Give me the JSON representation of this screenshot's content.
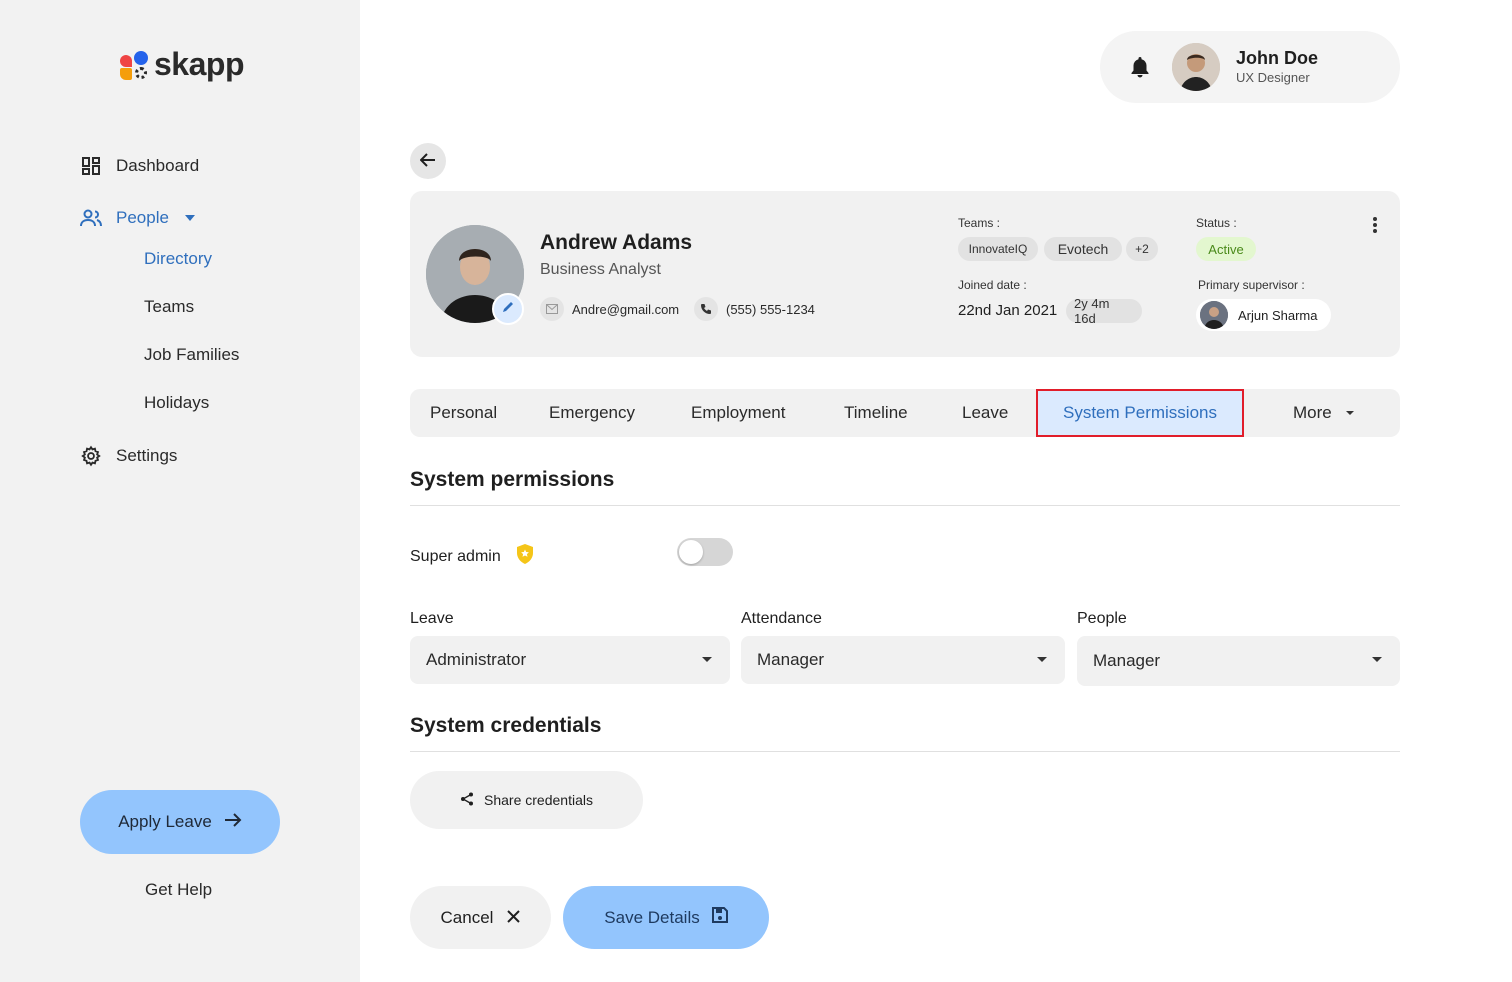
{
  "brand": {
    "name": "skapp"
  },
  "sidebar": {
    "nav": {
      "dashboard": "Dashboard",
      "people": "People",
      "settings": "Settings"
    },
    "people_sub": {
      "directory": "Directory",
      "teams": "Teams",
      "job_families": "Job Families",
      "holidays": "Holidays"
    },
    "apply_leave": "Apply Leave",
    "get_help": "Get Help"
  },
  "header": {
    "user_name": "John Doe",
    "user_role": "UX Designer"
  },
  "profile": {
    "name": "Andrew Adams",
    "title": "Business Analyst",
    "email": "Andre@gmail.com",
    "phone": "(555) 555-1234",
    "teams_label": "Teams :",
    "teams": [
      "InnovateIQ",
      "Evotech",
      "+2"
    ],
    "status_label": "Status :",
    "status": "Active",
    "joined_label": "Joined date :",
    "joined_date": "22nd Jan 2021",
    "tenure": "2y 4m 16d",
    "supervisor_label": "Primary supervisor :",
    "supervisor": "Arjun Sharma"
  },
  "tabs": {
    "personal": "Personal",
    "emergency": "Emergency",
    "employment": "Employment",
    "timeline": "Timeline",
    "leave": "Leave",
    "system_permissions": "System Permissions",
    "more": "More",
    "active": "System Permissions"
  },
  "permissions": {
    "section_title": "System permissions",
    "super_admin_label": "Super admin",
    "super_admin_enabled": false,
    "leave_label": "Leave",
    "leave_value": "Administrator",
    "attendance_label": "Attendance",
    "attendance_value": "Manager",
    "people_label": "People",
    "people_value": "Manager"
  },
  "credentials": {
    "section_title": "System credentials",
    "share_label": "Share credentials"
  },
  "actions": {
    "cancel": "Cancel",
    "save": "Save Details"
  },
  "colors": {
    "accent_blue": "#2f6fbd",
    "button_blue": "#93c5fd",
    "active_tab_bg": "#dbeafe",
    "highlight_red": "#e11d2a",
    "status_green": "#4a8a1a"
  }
}
